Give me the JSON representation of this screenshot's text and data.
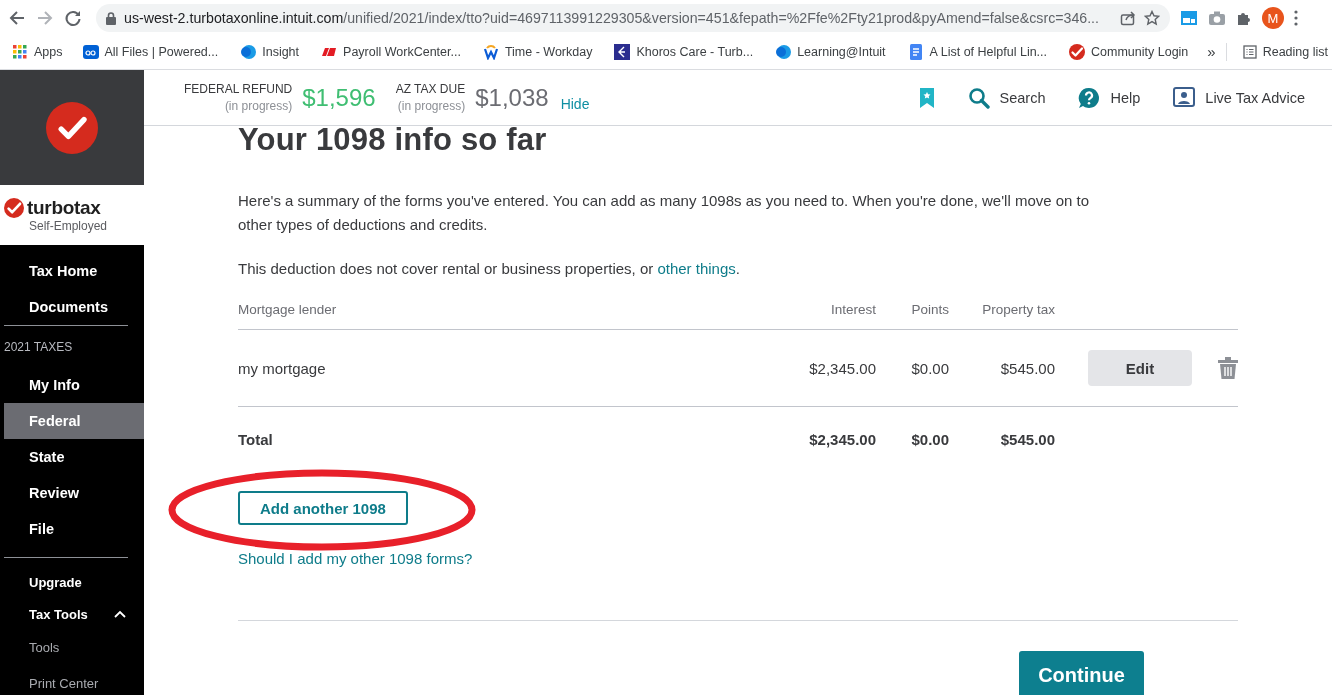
{
  "browser": {
    "url_host": "us-west-2.turbotaxonline.intuit.com",
    "url_path": "/unified/2021/index/tto?uid=4697113991229305&version=451&fepath=%2Ffe%2Fty21prod&pyAmend=false&csrc=346...",
    "profile_initial": "M",
    "bookmarks": [
      {
        "label": "Apps"
      },
      {
        "label": "All Files | Powered..."
      },
      {
        "label": "Insight"
      },
      {
        "label": "Payroll WorkCenter..."
      },
      {
        "label": "Time - Workday"
      },
      {
        "label": "Khoros Care - Turb..."
      },
      {
        "label": "Learning@Intuit"
      },
      {
        "label": "A List of Helpful Lin..."
      },
      {
        "label": "Community Login"
      }
    ],
    "overflow": "»",
    "reading_list": "Reading list"
  },
  "sidebar": {
    "product": "turbotax",
    "edition": "Self-Employed",
    "groups": [
      {
        "items": [
          {
            "label": "Tax Home",
            "selected": false
          },
          {
            "label": "Documents",
            "selected": false
          }
        ]
      },
      {
        "title": "2021 TAXES",
        "items": [
          {
            "label": "My Info",
            "selected": false
          },
          {
            "label": "Federal",
            "selected": true
          },
          {
            "label": "State",
            "selected": false
          },
          {
            "label": "Review",
            "selected": false
          },
          {
            "label": "File",
            "selected": false
          }
        ]
      }
    ],
    "upgrade": "Upgrade",
    "tax_tools": {
      "label": "Tax Tools",
      "expanded": true,
      "children": [
        {
          "label": "Tools"
        },
        {
          "label": "Print Center"
        }
      ]
    }
  },
  "topbar": {
    "summaries": [
      {
        "kind": "refund",
        "label": "FEDERAL REFUND",
        "status": "(in progress)",
        "amount": "$1,596"
      },
      {
        "kind": "due",
        "label": "AZ TAX DUE",
        "status": "(in progress)",
        "amount": "$1,038"
      }
    ],
    "hide": "Hide",
    "actions": [
      {
        "kind": "search",
        "label": "Search"
      },
      {
        "kind": "help",
        "label": "Help"
      },
      {
        "kind": "advice",
        "label": "Live Tax Advice"
      }
    ]
  },
  "main": {
    "title": "Your 1098 info so far",
    "intro": "Here's a summary of the forms you've entered. You can add as many 1098s as you need to. When you're done, we'll move on to other types of deductions and credits.",
    "note": {
      "before": "This deduction does not cover rental or business properties, or ",
      "link": "other things",
      "after": "."
    },
    "table": {
      "columns": [
        "Mortgage lender",
        "Interest",
        "Points",
        "Property tax"
      ],
      "rows": [
        {
          "cells": [
            "my mortgage",
            "$2,345.00",
            "$0.00",
            "$545.00"
          ],
          "action": "Edit"
        }
      ],
      "total": {
        "label": "Total",
        "values": [
          "$2,345.00",
          "$0.00",
          "$545.00"
        ]
      }
    },
    "add_button": "Add another 1098",
    "help_link": "Should I add my other 1098 forms?",
    "continue_button": "Continue"
  }
}
